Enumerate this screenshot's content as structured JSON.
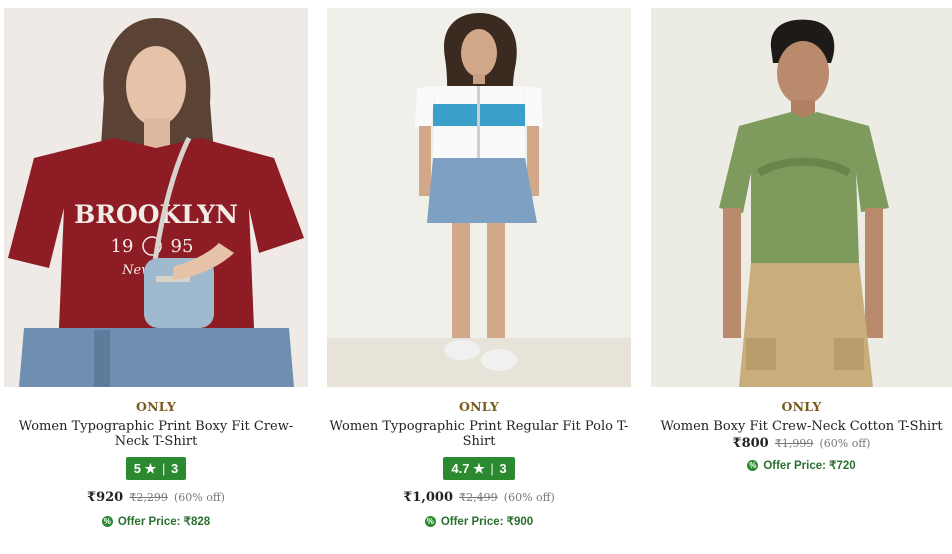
{
  "products": [
    {
      "brand": "ONLY",
      "title": "Women Typographic Print Boxy Fit Crew-Neck T-Shirt",
      "rating": {
        "score": "5",
        "star": "★",
        "count": "3"
      },
      "price": "₹920",
      "mrp": "₹2,299",
      "discount": "(60% off)",
      "offer_price": "Offer Price: ₹828",
      "image": {
        "print_text_1": "BROOKLYN",
        "print_text_2": "19",
        "print_text_3": "95",
        "print_text_4": "New York"
      }
    },
    {
      "brand": "ONLY",
      "title": "Women Typographic Print Regular Fit Polo T-Shirt",
      "rating": {
        "score": "4.7",
        "star": "★",
        "count": "3"
      },
      "price": "₹1,000",
      "mrp": "₹2,499",
      "discount": "(60% off)",
      "offer_price": "Offer Price: ₹900"
    },
    {
      "brand": "ONLY",
      "title": "Women Boxy Fit Crew-Neck Cotton T-Shirt",
      "price": "₹800",
      "mrp": "₹1,999",
      "discount": "(60% off)",
      "offer_price": "Offer Price: ₹720"
    }
  ],
  "colors": {
    "brand_text": "#7a5a1e",
    "rating_bg": "#2b8a2f",
    "offer_text": "#2b6f2f",
    "tee_maroon": "#8e1c24",
    "tee_olive": "#7e9a5c",
    "denim": "#6f8fb0"
  }
}
